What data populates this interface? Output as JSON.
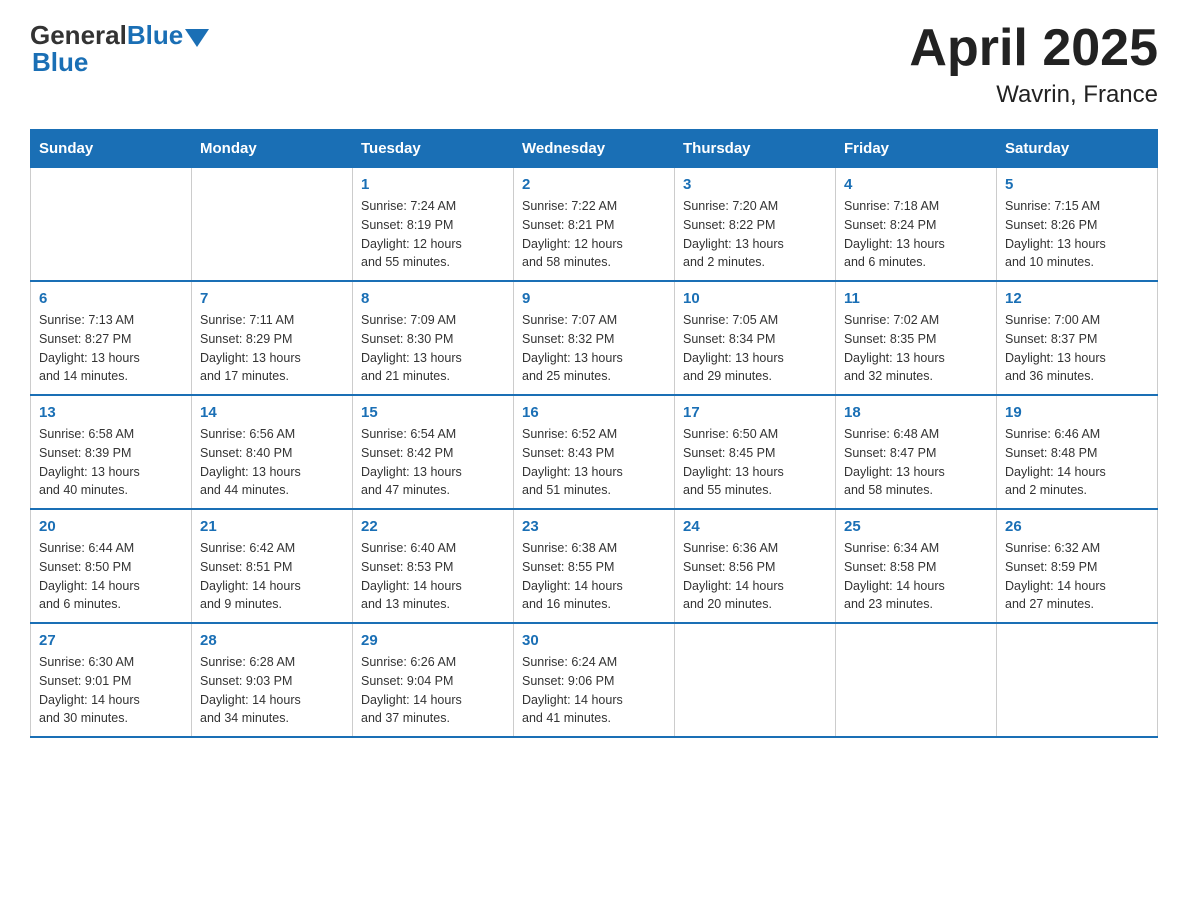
{
  "header": {
    "logo_general": "General",
    "logo_blue": "Blue",
    "title": "April 2025",
    "subtitle": "Wavrin, France"
  },
  "weekdays": [
    "Sunday",
    "Monday",
    "Tuesday",
    "Wednesday",
    "Thursday",
    "Friday",
    "Saturday"
  ],
  "weeks": [
    [
      {
        "day": "",
        "info": ""
      },
      {
        "day": "",
        "info": ""
      },
      {
        "day": "1",
        "info": "Sunrise: 7:24 AM\nSunset: 8:19 PM\nDaylight: 12 hours\nand 55 minutes."
      },
      {
        "day": "2",
        "info": "Sunrise: 7:22 AM\nSunset: 8:21 PM\nDaylight: 12 hours\nand 58 minutes."
      },
      {
        "day": "3",
        "info": "Sunrise: 7:20 AM\nSunset: 8:22 PM\nDaylight: 13 hours\nand 2 minutes."
      },
      {
        "day": "4",
        "info": "Sunrise: 7:18 AM\nSunset: 8:24 PM\nDaylight: 13 hours\nand 6 minutes."
      },
      {
        "day": "5",
        "info": "Sunrise: 7:15 AM\nSunset: 8:26 PM\nDaylight: 13 hours\nand 10 minutes."
      }
    ],
    [
      {
        "day": "6",
        "info": "Sunrise: 7:13 AM\nSunset: 8:27 PM\nDaylight: 13 hours\nand 14 minutes."
      },
      {
        "day": "7",
        "info": "Sunrise: 7:11 AM\nSunset: 8:29 PM\nDaylight: 13 hours\nand 17 minutes."
      },
      {
        "day": "8",
        "info": "Sunrise: 7:09 AM\nSunset: 8:30 PM\nDaylight: 13 hours\nand 21 minutes."
      },
      {
        "day": "9",
        "info": "Sunrise: 7:07 AM\nSunset: 8:32 PM\nDaylight: 13 hours\nand 25 minutes."
      },
      {
        "day": "10",
        "info": "Sunrise: 7:05 AM\nSunset: 8:34 PM\nDaylight: 13 hours\nand 29 minutes."
      },
      {
        "day": "11",
        "info": "Sunrise: 7:02 AM\nSunset: 8:35 PM\nDaylight: 13 hours\nand 32 minutes."
      },
      {
        "day": "12",
        "info": "Sunrise: 7:00 AM\nSunset: 8:37 PM\nDaylight: 13 hours\nand 36 minutes."
      }
    ],
    [
      {
        "day": "13",
        "info": "Sunrise: 6:58 AM\nSunset: 8:39 PM\nDaylight: 13 hours\nand 40 minutes."
      },
      {
        "day": "14",
        "info": "Sunrise: 6:56 AM\nSunset: 8:40 PM\nDaylight: 13 hours\nand 44 minutes."
      },
      {
        "day": "15",
        "info": "Sunrise: 6:54 AM\nSunset: 8:42 PM\nDaylight: 13 hours\nand 47 minutes."
      },
      {
        "day": "16",
        "info": "Sunrise: 6:52 AM\nSunset: 8:43 PM\nDaylight: 13 hours\nand 51 minutes."
      },
      {
        "day": "17",
        "info": "Sunrise: 6:50 AM\nSunset: 8:45 PM\nDaylight: 13 hours\nand 55 minutes."
      },
      {
        "day": "18",
        "info": "Sunrise: 6:48 AM\nSunset: 8:47 PM\nDaylight: 13 hours\nand 58 minutes."
      },
      {
        "day": "19",
        "info": "Sunrise: 6:46 AM\nSunset: 8:48 PM\nDaylight: 14 hours\nand 2 minutes."
      }
    ],
    [
      {
        "day": "20",
        "info": "Sunrise: 6:44 AM\nSunset: 8:50 PM\nDaylight: 14 hours\nand 6 minutes."
      },
      {
        "day": "21",
        "info": "Sunrise: 6:42 AM\nSunset: 8:51 PM\nDaylight: 14 hours\nand 9 minutes."
      },
      {
        "day": "22",
        "info": "Sunrise: 6:40 AM\nSunset: 8:53 PM\nDaylight: 14 hours\nand 13 minutes."
      },
      {
        "day": "23",
        "info": "Sunrise: 6:38 AM\nSunset: 8:55 PM\nDaylight: 14 hours\nand 16 minutes."
      },
      {
        "day": "24",
        "info": "Sunrise: 6:36 AM\nSunset: 8:56 PM\nDaylight: 14 hours\nand 20 minutes."
      },
      {
        "day": "25",
        "info": "Sunrise: 6:34 AM\nSunset: 8:58 PM\nDaylight: 14 hours\nand 23 minutes."
      },
      {
        "day": "26",
        "info": "Sunrise: 6:32 AM\nSunset: 8:59 PM\nDaylight: 14 hours\nand 27 minutes."
      }
    ],
    [
      {
        "day": "27",
        "info": "Sunrise: 6:30 AM\nSunset: 9:01 PM\nDaylight: 14 hours\nand 30 minutes."
      },
      {
        "day": "28",
        "info": "Sunrise: 6:28 AM\nSunset: 9:03 PM\nDaylight: 14 hours\nand 34 minutes."
      },
      {
        "day": "29",
        "info": "Sunrise: 6:26 AM\nSunset: 9:04 PM\nDaylight: 14 hours\nand 37 minutes."
      },
      {
        "day": "30",
        "info": "Sunrise: 6:24 AM\nSunset: 9:06 PM\nDaylight: 14 hours\nand 41 minutes."
      },
      {
        "day": "",
        "info": ""
      },
      {
        "day": "",
        "info": ""
      },
      {
        "day": "",
        "info": ""
      }
    ]
  ]
}
